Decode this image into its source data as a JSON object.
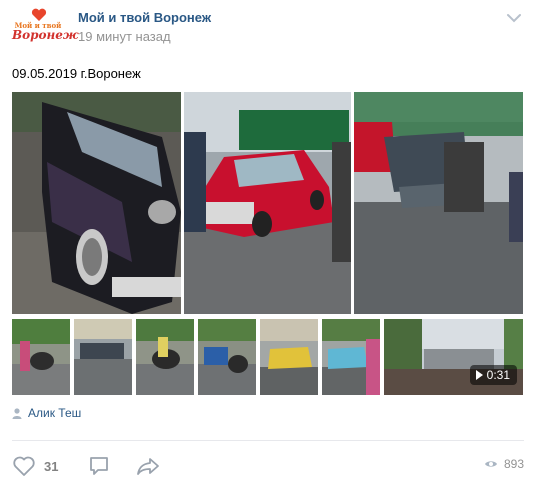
{
  "post": {
    "group_name": "Мой и твой Воронеж",
    "time": "19 минут назад",
    "text": "09.05.2019 г.Воронеж",
    "author": "Алик Теш",
    "likes": "31",
    "views": "893"
  },
  "avatar": {
    "line1": "Мой и твой",
    "line2": "Воронеж"
  },
  "video": {
    "duration": "0:31"
  },
  "icons": {
    "menu": "chevron-down-icon",
    "author": "person-icon",
    "like": "heart-icon",
    "comment": "comment-icon",
    "share": "share-icon",
    "views": "eye-icon",
    "play": "play-icon"
  },
  "colors": {
    "link": "#2a5885",
    "secondary": "#939393",
    "separator": "#e7e8ec"
  }
}
